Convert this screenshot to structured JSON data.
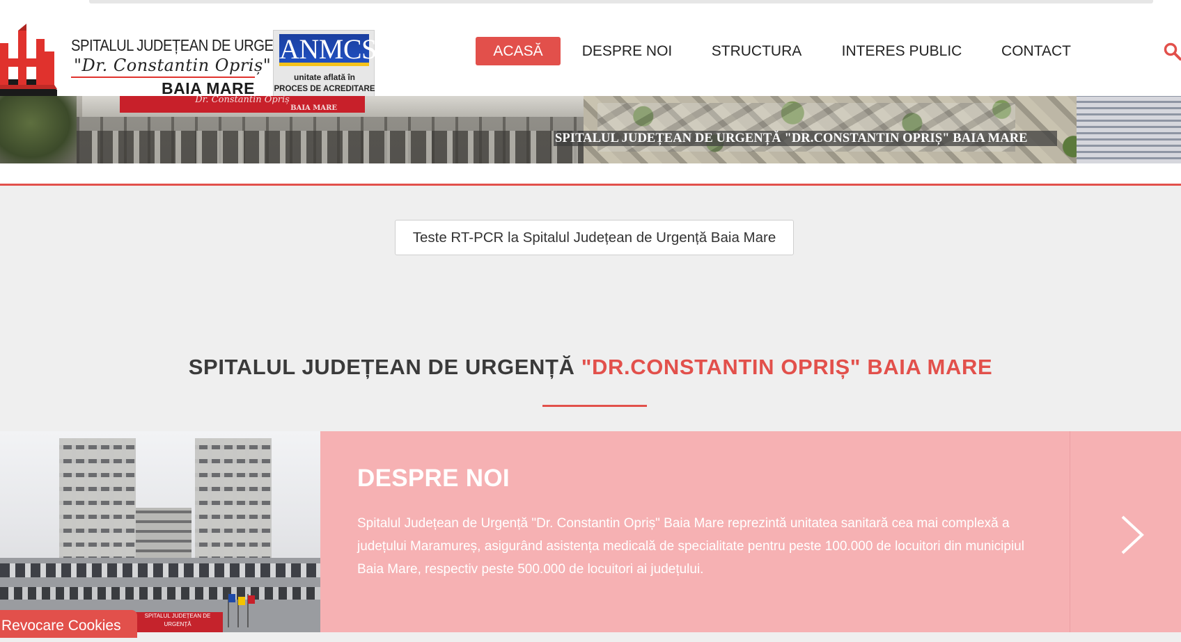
{
  "header": {
    "logo_line1": "SPITALUL JUDEȚEAN DE URGENȚĂ",
    "logo_line2": "\"Dr. Constantin Opriș\"",
    "logo_line3": "BAIA MARE",
    "anmcs_badge": "ANMCS",
    "anmcs_line1": "unitate aflată în",
    "anmcs_line2": "PROCES DE ACREDITARE"
  },
  "nav": {
    "items": [
      {
        "label": "ACASĂ",
        "active": true
      },
      {
        "label": "DESPRE NOI",
        "active": false
      },
      {
        "label": "STRUCTURA",
        "active": false
      },
      {
        "label": "INTERES PUBLIC",
        "active": false
      },
      {
        "label": "CONTACT",
        "active": false
      }
    ],
    "search_icon": "search-icon"
  },
  "banner": {
    "sign_text": "Dr. Constantin Opriș",
    "sign_small": "BAIA MARE",
    "caption": "SPITALUL JUDEȚEAN DE URGENȚĂ \"DR.CONSTANTIN OPRIȘ\" BAIA MARE"
  },
  "notice": {
    "label": "Teste RT-PCR la Spitalul Județean de Urgență Baia Mare"
  },
  "section": {
    "title_dark": "SPITALUL JUDEȚEAN DE URGENȚĂ ",
    "title_red": "\"DR.CONSTANTIN OPRIȘ\" BAIA MARE"
  },
  "about": {
    "heading": "DESPRE NOI",
    "text": "Spitalul Județean de Urgență \"Dr. Constantin Opriș\" Baia Mare reprezintă unitatea sanitară cea mai complexă a județului Maramureș, asigurând asistența medicală de specialitate pentru peste 100.000 de locuitori din municipiul Baia Mare, respectiv peste 500.000 de locuitori ai județului.",
    "photo_sign": "SPITALUL JUDEȚEAN DE URGENȚĂ",
    "next_icon": "chevron-right-icon"
  },
  "cookie": {
    "label": "Revocare Cookies"
  },
  "colors": {
    "accent": "#e2504b",
    "panel": "#f6b1b3",
    "background": "#efefef"
  }
}
